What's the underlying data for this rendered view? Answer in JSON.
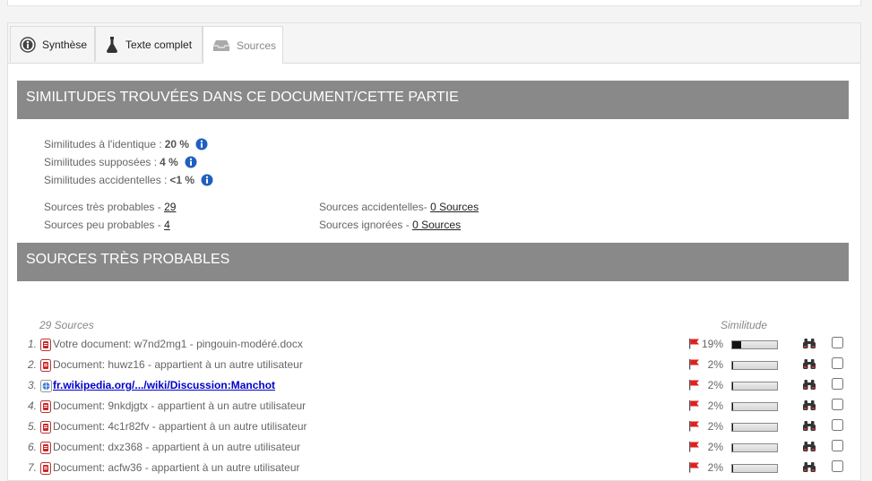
{
  "tabs": [
    {
      "label": "Synthèse",
      "icon": "summary-icon"
    },
    {
      "label": "Texte complet",
      "icon": "flask-icon"
    },
    {
      "label": "Sources",
      "icon": "inbox-icon",
      "active": true
    }
  ],
  "similarities": {
    "heading": "SIMILITUDES TROUVÉES DANS CE DOCUMENT/CETTE PARTIE",
    "identical_label": "Similitudes à l'identique :",
    "identical_value": "20 %",
    "supposed_label": "Similitudes supposées :",
    "supposed_value": "4 %",
    "accidental_label": "Similitudes accidentelles :",
    "accidental_value": "<1 %"
  },
  "source_counts": {
    "very_probable_label": "Sources très probables - ",
    "very_probable_value": "29",
    "unlikely_label": "Sources peu probables - ",
    "unlikely_value": "4",
    "accidental_label": "Sources accidentelles- ",
    "accidental_value": "0 Sources",
    "ignored_label": "Sources ignorées - ",
    "ignored_value": "0 Sources"
  },
  "very_probable": {
    "heading": "SOURCES TRÈS PROBABLES",
    "count_label": "29 Sources",
    "similarity_label": "Similitude",
    "rows": [
      {
        "num": "1.",
        "type": "document",
        "title": "Votre document: w7nd2mg1 - pingouin-modéré.docx",
        "pct": "19%",
        "fill": 0.19
      },
      {
        "num": "2.",
        "type": "document",
        "title": "Document: huwz16 - appartient à un autre utilisateur",
        "pct": "2%",
        "fill": 0.02
      },
      {
        "num": "3.",
        "type": "web",
        "title": "fr.wikipedia.org/.../wiki/Discussion:Manchot",
        "pct": "2%",
        "fill": 0.02
      },
      {
        "num": "4.",
        "type": "document",
        "title": "Document: 9nkdjgtx - appartient à un autre utilisateur",
        "pct": "2%",
        "fill": 0.02
      },
      {
        "num": "5.",
        "type": "document",
        "title": "Document: 4c1r82fv - appartient à un autre utilisateur",
        "pct": "2%",
        "fill": 0.02
      },
      {
        "num": "6.",
        "type": "document",
        "title": "Document: dxz368 - appartient à un autre utilisateur",
        "pct": "2%",
        "fill": 0.02
      },
      {
        "num": "7.",
        "type": "document",
        "title": "Document: acfw36 - appartient à un autre utilisateur",
        "pct": "2%",
        "fill": 0.02
      }
    ]
  },
  "colors": {
    "header_bg": "#8a8989",
    "flag": "#e02020",
    "info": "#1f5fbf",
    "link": "#0000cc"
  }
}
